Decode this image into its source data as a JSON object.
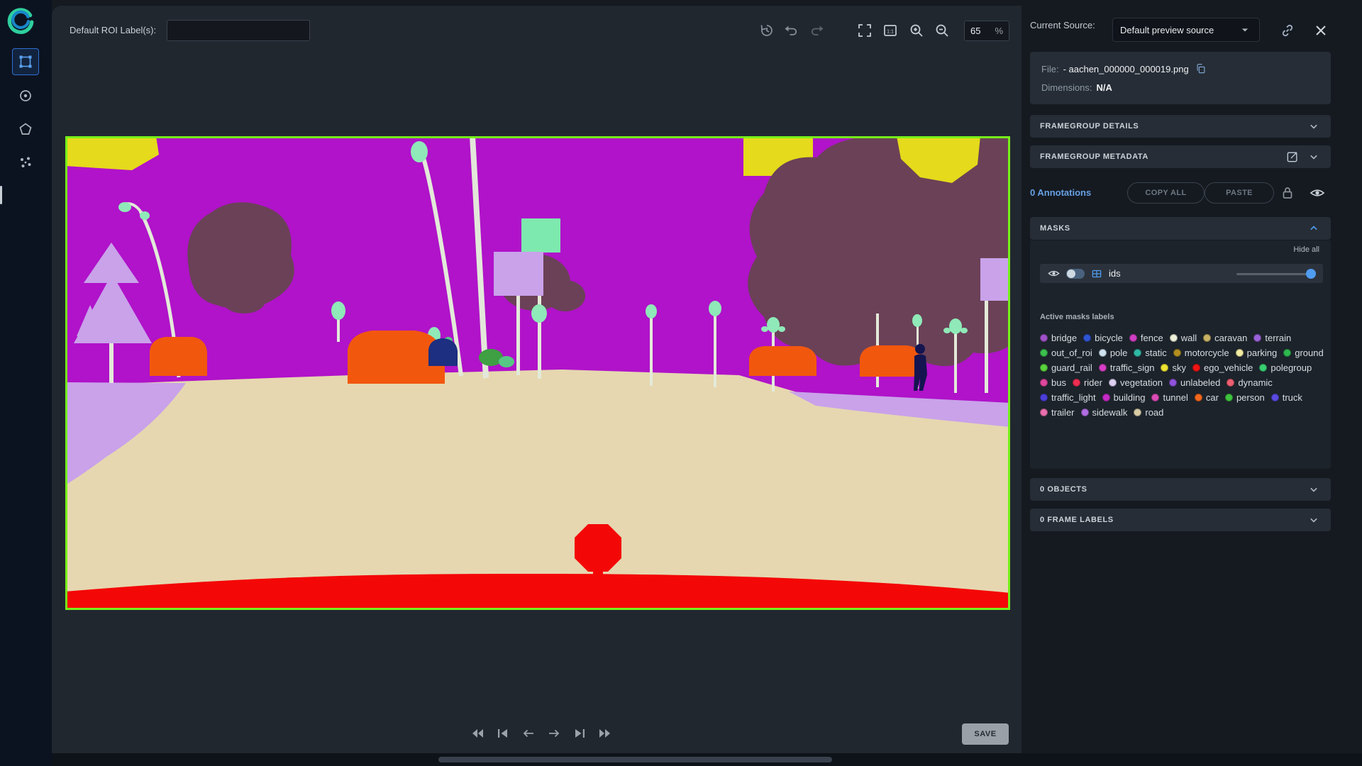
{
  "toolbar": {
    "roi_label": "Default ROI Label(s):",
    "roi_value": "",
    "zoom_value": "65",
    "zoom_unit": "%"
  },
  "source_bar": {
    "label": "Current Source:",
    "selected": "Default preview source"
  },
  "file_info": {
    "file_label": "File:",
    "file_name": "- aachen_000000_000019.png",
    "dimensions_label": "Dimensions:",
    "dimensions_value": "N/A"
  },
  "sections": {
    "framegroup_details": "FRAMEGROUP DETAILS",
    "framegroup_metadata": "FRAMEGROUP METADATA",
    "objects": "0 OBJECTS",
    "frame_labels": "0 FRAME LABELS"
  },
  "annotations": {
    "count": "0 Annotations",
    "copy_all": "COPY ALL",
    "paste": "PASTE"
  },
  "masks": {
    "title": "MASKS",
    "hide_all": "Hide all",
    "layer_name": "ids",
    "active_title": "Active masks labels",
    "labels": [
      {
        "name": "bridge",
        "color": "#a052c8"
      },
      {
        "name": "bicycle",
        "color": "#2f55d4"
      },
      {
        "name": "fence",
        "color": "#cf3fc2"
      },
      {
        "name": "wall",
        "color": "#eef2da"
      },
      {
        "name": "caravan",
        "color": "#c9b264"
      },
      {
        "name": "terrain",
        "color": "#9a62d8"
      },
      {
        "name": "out_of_roi",
        "color": "#3bbf4e"
      },
      {
        "name": "pole",
        "color": "#cfe2f0"
      },
      {
        "name": "static",
        "color": "#2fb9a5"
      },
      {
        "name": "motorcycle",
        "color": "#b28f21"
      },
      {
        "name": "parking",
        "color": "#f2eda2"
      },
      {
        "name": "ground",
        "color": "#2eb84f"
      },
      {
        "name": "guard_rail",
        "color": "#5ad23e"
      },
      {
        "name": "traffic_sign",
        "color": "#d63fc4"
      },
      {
        "name": "sky",
        "color": "#f0e432"
      },
      {
        "name": "ego_vehicle",
        "color": "#f01414"
      },
      {
        "name": "polegroup",
        "color": "#37cf72"
      },
      {
        "name": "bus",
        "color": "#e0479e"
      },
      {
        "name": "rider",
        "color": "#ef2d52"
      },
      {
        "name": "vegetation",
        "color": "#ded0f2"
      },
      {
        "name": "unlabeled",
        "color": "#8f52dc"
      },
      {
        "name": "dynamic",
        "color": "#ee5f72"
      },
      {
        "name": "traffic_light",
        "color": "#4b3fd8"
      },
      {
        "name": "building",
        "color": "#c62ac6"
      },
      {
        "name": "tunnel",
        "color": "#da4cb4"
      },
      {
        "name": "car",
        "color": "#f2681c"
      },
      {
        "name": "person",
        "color": "#3ec43e"
      },
      {
        "name": "truck",
        "color": "#5a4ae0"
      },
      {
        "name": "trailer",
        "color": "#ea6fae"
      },
      {
        "name": "sidewalk",
        "color": "#b26ee4"
      },
      {
        "name": "road",
        "color": "#d9cda6"
      }
    ]
  },
  "transport": {
    "icons": [
      "fast-backward",
      "skip-to-start",
      "previous",
      "next",
      "skip-to-end",
      "fast-forward"
    ]
  },
  "save_button": "SAVE",
  "canvas": {
    "border_color": "#76f019"
  }
}
